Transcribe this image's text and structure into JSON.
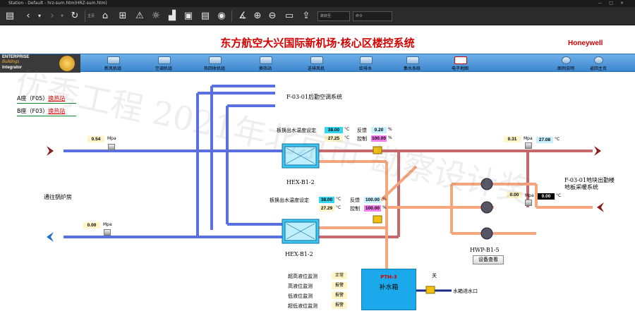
{
  "window": {
    "title": "Station - Default - hrz-sum.htm(HRZ-sum.htm)"
  },
  "toolbar": {
    "home_label": "主页",
    "field1": "跳转至",
    "field2": "命令"
  },
  "header": {
    "title": "东方航空大兴国际新机场·核心区楼控系统",
    "brand": "Honeywell",
    "ebi": {
      "line1": "ENTERPRISE",
      "line2": "Buildings",
      "line3": "Integrator"
    }
  },
  "nav": {
    "items": [
      {
        "label": "新风机组"
      },
      {
        "label": "空调机组"
      },
      {
        "label": "热回收机组"
      },
      {
        "label": "换热站"
      },
      {
        "label": "送排风机"
      },
      {
        "label": "给排水"
      },
      {
        "label": "集水系统"
      },
      {
        "label": "电子地图"
      },
      {
        "label": "图例说明"
      },
      {
        "label": "返回主页"
      }
    ]
  },
  "links": {
    "a_prefix": "A座（F05）",
    "a_link": "换热站",
    "b_prefix": "B座（F03）",
    "b_link": "换热站"
  },
  "labels": {
    "top_system": "F-03-01后勤空调系统",
    "boiler": "通往锅炉房",
    "right_system_1": "F-03-01地块出勤楼",
    "right_system_2": "地板采暖系统",
    "hex1": "HEX-B1-2",
    "hex2": "HEX-B1-2",
    "pumps": "HWP-B1-5",
    "pump_btn": "设备查看",
    "tank_code": "PTH-3",
    "tank_name": "补水箱",
    "inlet": "水箱进水口",
    "valve_state": "关"
  },
  "hex1": {
    "setpoint_label": "板换出水温度设定",
    "setpoint": "38.00",
    "actual": "27.25",
    "fb_label": "反馈",
    "fb": "0.20",
    "ctrl_label": "控制",
    "ctrl": "100.00"
  },
  "hex2": {
    "setpoint_label": "板换出水温度设定",
    "setpoint": "38.00",
    "actual": "27.29",
    "fb_label": "反馈",
    "fb": "100.00",
    "ctrl_label": "控制",
    "ctrl": "100.00"
  },
  "pressures": {
    "left_supply": "0.54",
    "left_return": "0.00",
    "right_supply": "0.31",
    "right_return": "0.00",
    "unit": "Mpa"
  },
  "temps": {
    "right_supply": "27.08",
    "right_return": "0.00",
    "unit": "°C"
  },
  "level_monitor": [
    {
      "label": "超高液位监测",
      "status": "正常"
    },
    {
      "label": "高液位监测",
      "status": "报警"
    },
    {
      "label": "低液位监测",
      "status": "报警"
    },
    {
      "label": "超低液位监测",
      "status": "报警"
    }
  ],
  "percent": "%",
  "deg": "°C",
  "watermark": "优秀工程 2021年北京市 勘察设计奖"
}
